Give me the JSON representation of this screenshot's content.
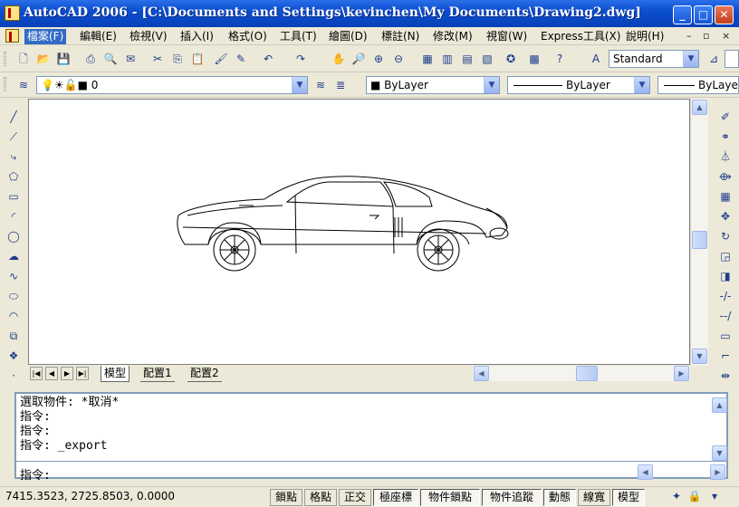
{
  "title": "AutoCAD 2006 - [C:\\Documents and Settings\\kevinchen\\My Documents\\Drawing2.dwg]",
  "window_controls": {
    "minimize": "_",
    "maximize": "□",
    "close": "✕"
  },
  "menu": {
    "items": [
      "檔案(F)",
      "編輯(E)",
      "檢視(V)",
      "插入(I)",
      "格式(O)",
      "工具(T)",
      "繪圖(D)",
      "標註(N)",
      "修改(M)",
      "視窗(W)",
      "Express工具(X)",
      "說明(H)"
    ],
    "doc_controls": {
      "minimize": "–",
      "restore": "▫",
      "close": "×"
    }
  },
  "standard_toolbar": {
    "text_style": "Standard",
    "icons": [
      "new-icon",
      "open-icon",
      "save-icon",
      "plot-icon",
      "plot-preview-icon",
      "publish-icon",
      "cut-icon",
      "copy-icon",
      "paste-icon",
      "match-properties-icon",
      "block-editor-icon",
      "undo-icon",
      "redo-icon",
      "pan-icon",
      "zoom-realtime-icon",
      "zoom-window-icon",
      "zoom-previous-icon",
      "properties-icon",
      "design-center-icon",
      "tool-palettes-icon",
      "sheet-set-icon",
      "markup-icon",
      "calculator-icon",
      "help-icon",
      "text-style-icon",
      "dimension-style-icon"
    ]
  },
  "layers_toolbar": {
    "current_layer": "0"
  },
  "properties_toolbar": {
    "color": "ByLayer",
    "linetype": "ByLayer",
    "lineweight": "ByLayer"
  },
  "draw_toolbar": {
    "icons": [
      "line-icon",
      "construction-line-icon",
      "polyline-icon",
      "polygon-icon",
      "rectangle-icon",
      "arc-icon",
      "circle-icon",
      "revision-cloud-icon",
      "spline-icon",
      "ellipse-icon",
      "ellipse-arc-icon",
      "insert-block-icon",
      "make-block-icon",
      "point-icon"
    ]
  },
  "modify_toolbar": {
    "icons": [
      "erase-icon",
      "copy-object-icon",
      "mirror-icon",
      "offset-icon",
      "array-icon",
      "move-icon",
      "rotate-icon",
      "scale-icon",
      "stretch-icon",
      "trim-icon",
      "extend-icon",
      "break-icon",
      "chamfer-icon",
      "fillet-icon"
    ]
  },
  "layout_tabs": [
    "模型",
    "配置1",
    "配置2"
  ],
  "command": {
    "history": [
      "選取物件: *取消*",
      "指令:",
      "指令:",
      "指令: _export"
    ],
    "prompt": "指令:"
  },
  "status": {
    "coordinates": "7415.3523, 2725.8503, 0.0000",
    "toggles": [
      "鎖點",
      "格點",
      "正交",
      "極座標",
      "物件鎖點",
      "物件追蹤",
      "動態",
      "線寬",
      "模型"
    ]
  }
}
